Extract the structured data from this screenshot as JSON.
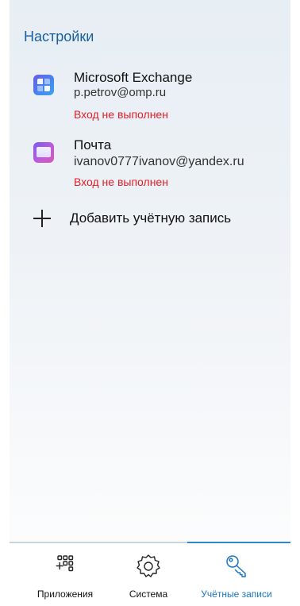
{
  "header": {
    "title": "Настройки"
  },
  "accounts": [
    {
      "title": "Microsoft Exchange",
      "email": "p.petrov@omp.ru",
      "status": "Вход не выполнен",
      "icon": "exchange-app-icon"
    },
    {
      "title": "Почта",
      "email": "ivanov0777ivanov@yandex.ru",
      "status": "Вход не выполнен",
      "icon": "mail-app-icon"
    }
  ],
  "add_account": {
    "label": "Добавить учётную запись",
    "icon": "plus-icon"
  },
  "tabs": [
    {
      "label": "Приложения",
      "icon": "apps-grid-icon",
      "active": false
    },
    {
      "label": "Система",
      "icon": "gear-icon",
      "active": false
    },
    {
      "label": "Учётные записи",
      "icon": "key-icon",
      "active": true
    }
  ],
  "colors": {
    "title": "#1a5fa0",
    "error": "#e0202a",
    "accent": "#2f86c8"
  }
}
